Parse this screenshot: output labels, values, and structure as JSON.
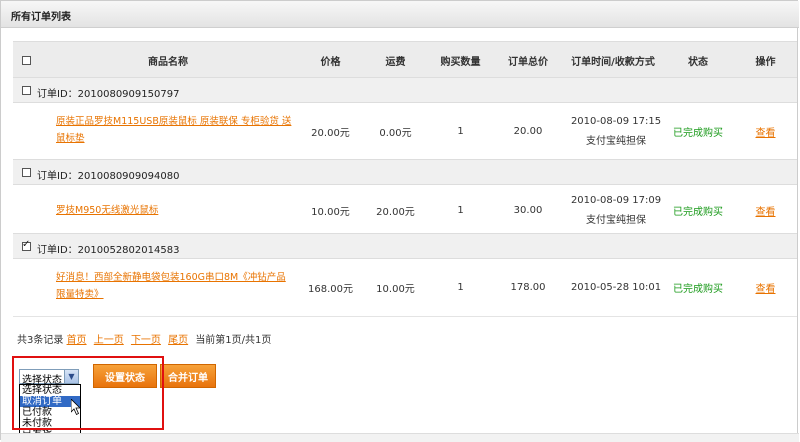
{
  "panel": {
    "title": "所有订单列表"
  },
  "table": {
    "headers": {
      "name": "商品名称",
      "price": "价格",
      "shipping": "运费",
      "qty": "购买数量",
      "total": "订单总价",
      "time": "订单时间/收款方式",
      "status": "状态",
      "action": "操作"
    },
    "orders": [
      {
        "id_label": "订单ID：2010080909150797",
        "checked": false,
        "product_line1": "原装正品罗技M115USB原装鼠标 原装联保 专柜验货 送",
        "product_line2": "鼠标垫",
        "price": "20.00元",
        "shipping": "0.00元",
        "qty": "1",
        "total": "20.00",
        "time": "2010-08-09 17:15",
        "payment": "支付宝纯担保",
        "status": "已完成购买",
        "action": "查看"
      },
      {
        "id_label": "订单ID：2010080909094080",
        "checked": false,
        "product_line1": "罗技M950无线激光鼠标",
        "product_line2": "",
        "price": "10.00元",
        "shipping": "20.00元",
        "qty": "1",
        "total": "30.00",
        "time": "2010-08-09 17:09",
        "payment": "支付宝纯担保",
        "status": "已完成购买",
        "action": "查看"
      },
      {
        "id_label": "订单ID：2010052802014583",
        "checked": true,
        "product_line1": "好消息！西部全新静电袋包装160G串口8M《冲钻产品",
        "product_line2": "限量特卖》",
        "price": "168.00元",
        "shipping": "10.00元",
        "qty": "1",
        "total": "178.00",
        "time": "2010-05-28 10:01",
        "payment": "",
        "status": "已完成购买",
        "action": "查看"
      }
    ]
  },
  "pager": {
    "summary": "共3条记录",
    "first": "首页",
    "prev": "上一页",
    "next": "下一页",
    "last": "尾页",
    "current": "当前第1页/共1页"
  },
  "status_select": {
    "value": "选择状态",
    "options": [
      "选择状态",
      "取消订单",
      "已付款",
      "未付款",
      "已发货"
    ],
    "highlighted_index": 1
  },
  "buttons": {
    "set_status": "设置状态",
    "merge_orders": "合并订单"
  },
  "colors": {
    "link": "#e87300",
    "status_green": "#1a9a1a",
    "button": "#e8730c",
    "highlight_box": "#e01010"
  }
}
